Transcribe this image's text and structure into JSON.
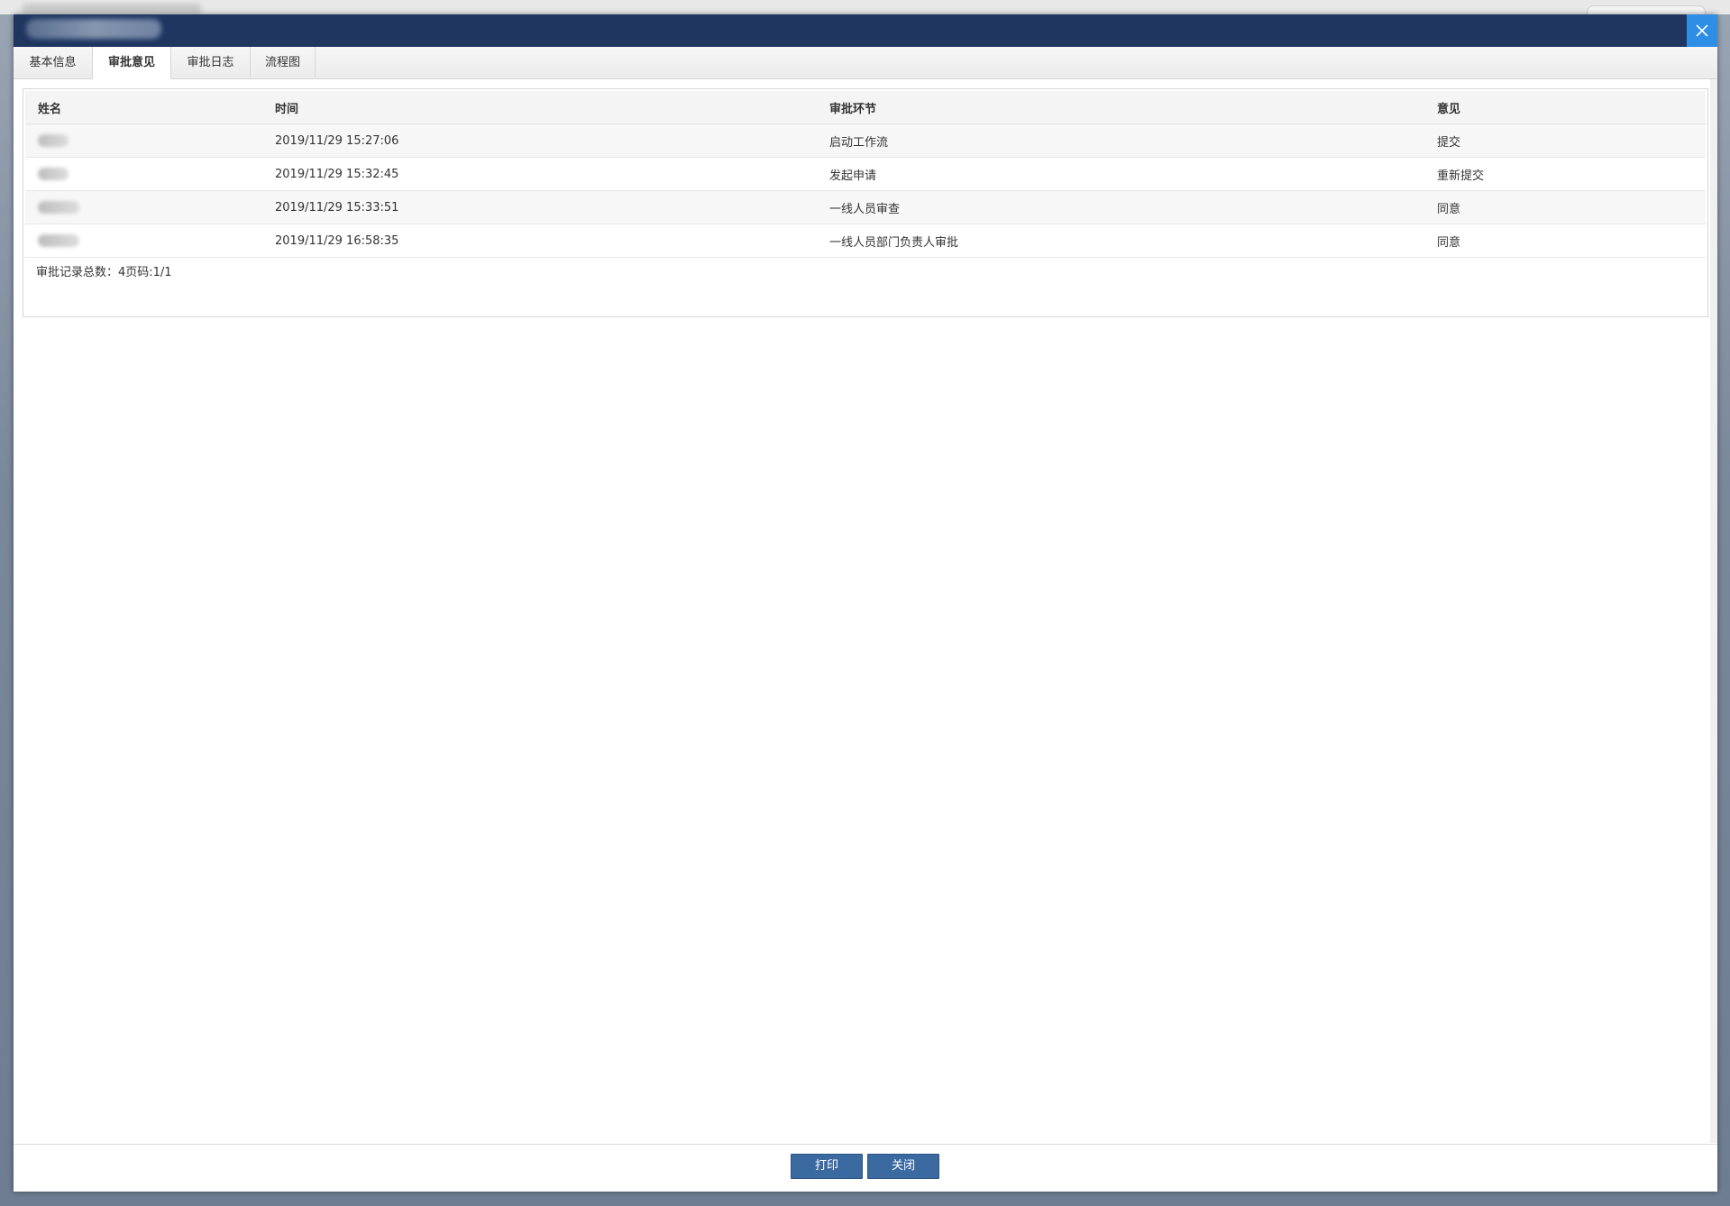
{
  "dialog": {
    "title": "",
    "close_icon": "close-icon"
  },
  "tabs": [
    {
      "label": "基本信息"
    },
    {
      "label": "审批意见"
    },
    {
      "label": "审批日志"
    },
    {
      "label": "流程图"
    }
  ],
  "table": {
    "headers": {
      "name": "姓名",
      "time": "时间",
      "step": "审批环节",
      "opinion": "意见"
    },
    "rows": [
      {
        "time": "2019/11/29 15:27:06",
        "step": "启动工作流",
        "opinion": "提交"
      },
      {
        "time": "2019/11/29 15:32:45",
        "step": "发起申请",
        "opinion": "重新提交"
      },
      {
        "time": "2019/11/29 15:33:51",
        "step": "一线人员审查",
        "opinion": "同意"
      },
      {
        "time": "2019/11/29 16:58:35",
        "step": "一线人员部门负责人审批",
        "opinion": "同意"
      }
    ],
    "summary": "审批记录总数：4页码:1/1"
  },
  "footer": {
    "print_label": "打印",
    "close_label": "关闭"
  },
  "colors": {
    "titlebar": "#1e3660",
    "close_button": "#2e8ee6",
    "primary_button": "#3b6aa1"
  }
}
